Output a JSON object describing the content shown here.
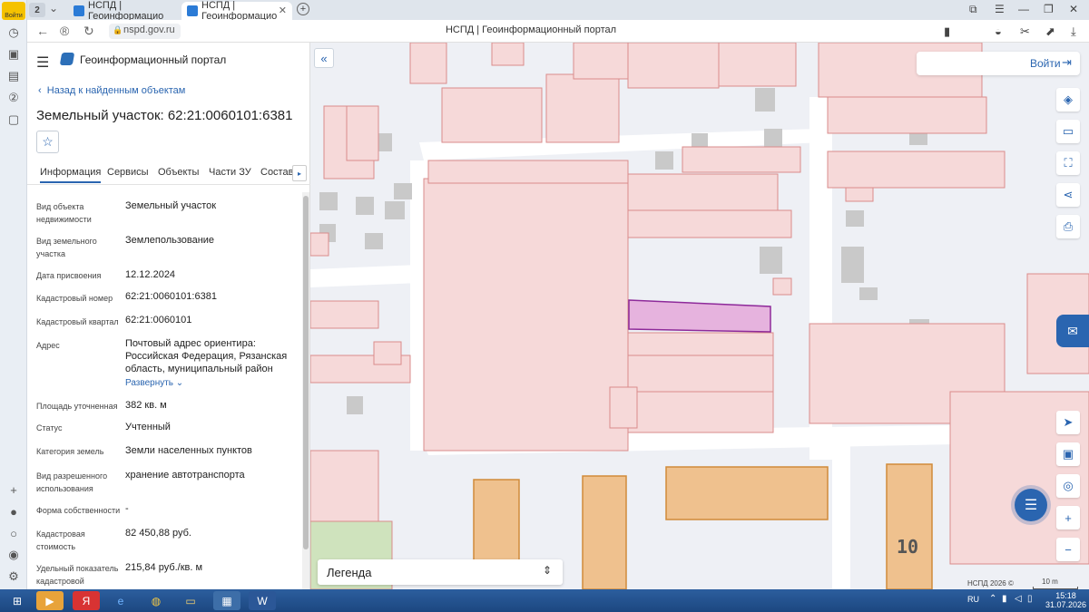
{
  "browser": {
    "login_badge": "Войти",
    "tab_count": "2",
    "tabs": [
      {
        "label": "НСПД | Геоинформацио"
      },
      {
        "label": "НСПД | Геоинформацио"
      }
    ],
    "url": "nspd.gov.ru",
    "page_title": "НСПД | Геоинформационный портал"
  },
  "panel": {
    "portal_title": "Геоинформационный портал",
    "back_link": "Назад к найденным объектам",
    "title": "Земельный участок: 62:21:0060101:6381",
    "tabs": [
      "Информация",
      "Сервисы",
      "Объекты",
      "Части ЗУ",
      "Состав"
    ],
    "properties": [
      {
        "label": "Вид объекта недвижимости",
        "value": "Земельный участок"
      },
      {
        "label": "Вид земельного участка",
        "value": "Землепользование"
      },
      {
        "label": "Дата присвоения",
        "value": "12.12.2024"
      },
      {
        "label": "Кадастровый номер",
        "value": "62:21:0060101:6381"
      },
      {
        "label": "Кадастровый квартал",
        "value": "62:21:0060101"
      },
      {
        "label": "Адрес",
        "value": "Почтовый адрес ориентира: Российская Федерация, Рязанская область, муниципальный район"
      },
      {
        "label": "Площадь уточненная",
        "value": "382 кв. м"
      },
      {
        "label": "Статус",
        "value": "Учтенный"
      },
      {
        "label": "Категория земель",
        "value": "Земли населенных пунктов"
      },
      {
        "label": "Вид разрешенного использования",
        "value": "хранение автотранспорта"
      },
      {
        "label": "Форма собственности",
        "value": "-"
      },
      {
        "label": "Кадастровая стоимость",
        "value": "82 450,88 руб."
      },
      {
        "label": "Удельный показатель кадастровой",
        "value": "215,84 руб./кв. м"
      }
    ],
    "expand_link": "Развернуть"
  },
  "map": {
    "login_label": "Войти",
    "legend_label": "Легенда",
    "copyright": "НСПД 2026 ©",
    "scale_label": "10 m",
    "house_number": "10",
    "colors": {
      "parcel_fill": "#f6d9d9",
      "parcel_stroke": "#d98c8c",
      "selected_fill": "#e6b3de",
      "selected_stroke": "#8e2a9a",
      "building_fill": "#efc18e",
      "building_stroke": "#d08a3a"
    }
  },
  "taskbar": {
    "lang": "RU",
    "time": "15:18",
    "date": "31.07.2026"
  }
}
